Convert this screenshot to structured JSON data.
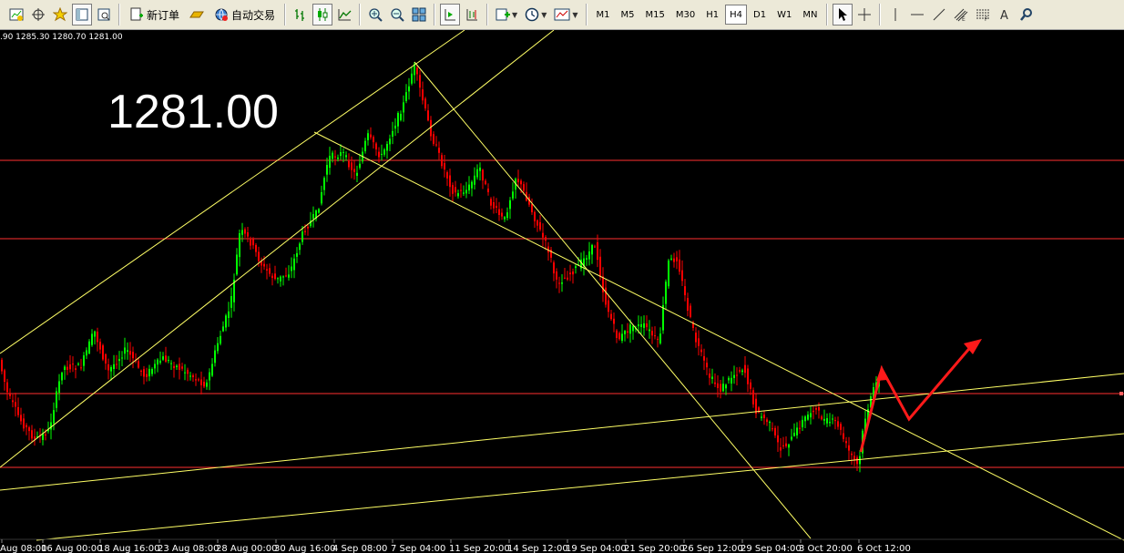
{
  "toolbar": {
    "new_order_label": "新订单",
    "auto_trading_label": "自动交易",
    "timeframes": [
      {
        "label": "M1",
        "active": false
      },
      {
        "label": "M5",
        "active": false
      },
      {
        "label": "M15",
        "active": false
      },
      {
        "label": "M30",
        "active": false
      },
      {
        "label": "H1",
        "active": false
      },
      {
        "label": "H4",
        "active": true
      },
      {
        "label": "D1",
        "active": false
      },
      {
        "label": "W1",
        "active": false
      },
      {
        "label": "MN",
        "active": false
      }
    ],
    "icons": {
      "new_chart": "new-chart-icon",
      "crosshair": "crosshair-icon",
      "favorites": "favorites-icon",
      "navigator": "navigator-icon",
      "data_window": "data-window-icon",
      "gold": "gold-bar-icon",
      "globe": "globe-icon",
      "bar_chart": "bar-chart-icon",
      "candle_chart": "candlestick-icon",
      "line_chart": "line-chart-icon",
      "zoom_in": "zoom-in-icon",
      "zoom_out": "zoom-out-icon",
      "tile": "tile-windows-icon",
      "autoscroll": "autoscroll-icon",
      "chart_shift": "chart-shift-icon",
      "indicators": "indicators-icon",
      "periods": "clock-icon",
      "templates": "template-icon",
      "cursor": "cursor-icon",
      "crosshair_tool": "crosshair-tool-icon",
      "vline": "vertical-line-icon",
      "hline": "horizontal-line-icon",
      "trendline": "trendline-icon",
      "channel": "equidistant-channel-icon",
      "fibo": "fibonacci-icon",
      "text": "text-icon",
      "search": "search-icon"
    }
  },
  "chart": {
    "ohlc_text": ".90 1285.30 1280.70 1281.00",
    "big_price": "1281.00",
    "x_labels": [
      "Aug 08:00",
      "16 Aug 00:00",
      "18 Aug 16:00",
      "23 Aug 08:00",
      "28 Aug 00:00",
      "30 Aug 16:00",
      "4 Sep 08:00",
      "7 Sep 04:00",
      "11 Sep 20:00",
      "14 Sep 12:00",
      "19 Sep 04:00",
      "21 Sep 20:00",
      "26 Sep 12:00",
      "29 Sep 04:00",
      "3 Oct 20:00",
      "6 Oct 12:00"
    ],
    "colors": {
      "background": "#000000",
      "bull_candle": "#00ff00",
      "bear_candle": "#ff0000",
      "trendline": "#ffff66",
      "level_line": "#ff3030",
      "arrow": "#ff1a1a"
    }
  }
}
